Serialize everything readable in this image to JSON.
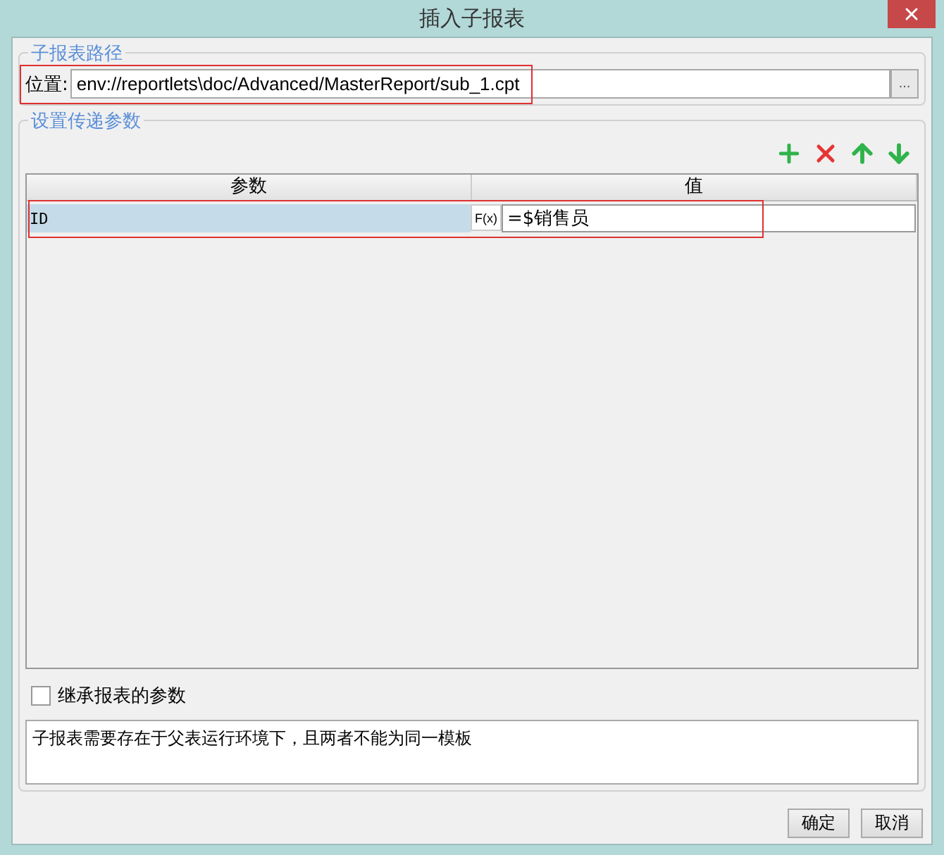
{
  "window": {
    "title": "插入子报表"
  },
  "report_path": {
    "legend": "子报表路径",
    "label": "位置:",
    "value": "env://reportlets\\doc/Advanced/MasterReport/sub_1.cpt",
    "browse": "..."
  },
  "parameters": {
    "legend": "设置传递参数",
    "toolbar": [
      {
        "kind": "add"
      },
      {
        "kind": "delete"
      },
      {
        "kind": "up"
      },
      {
        "kind": "down"
      }
    ],
    "columns": [
      "参数",
      "值"
    ],
    "rows": [
      {
        "name": "ID",
        "formula": "F(x)",
        "value": "=$销售员",
        "selected": true
      }
    ]
  },
  "inherit": {
    "label": "继承报表的参数",
    "checked": false
  },
  "note": "子报表需要存在于父表运行环境下，且两者不能为同一模板",
  "buttons": [
    "确定",
    "取消"
  ]
}
